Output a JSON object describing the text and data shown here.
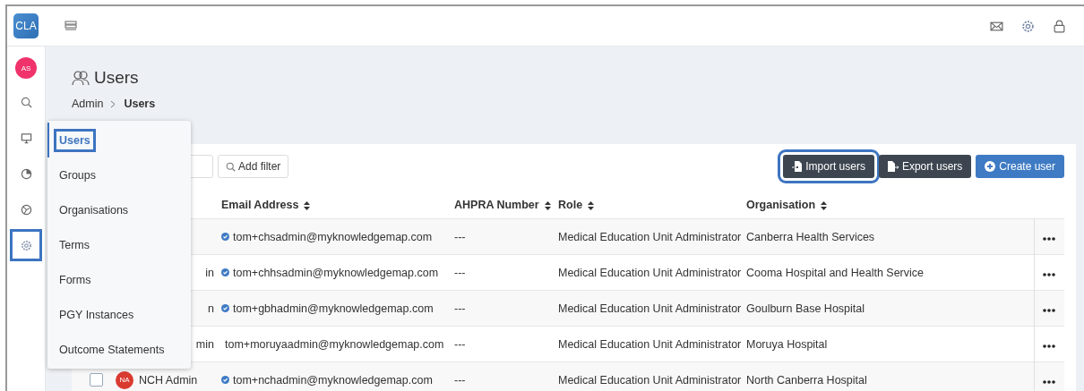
{
  "app": {
    "logo": "CLA"
  },
  "user_avatar": {
    "initials": "AS"
  },
  "rail_icons": [
    {
      "kind": "search",
      "highlighted": false
    },
    {
      "kind": "monitor",
      "highlighted": false
    },
    {
      "kind": "gauge",
      "highlighted": false
    },
    {
      "kind": "globe",
      "highlighted": false
    },
    {
      "kind": "gear",
      "highlighted": true
    }
  ],
  "header_icons": [
    {
      "kind": "mail"
    },
    {
      "kind": "gear"
    },
    {
      "kind": "lock"
    }
  ],
  "page": {
    "title": "Users",
    "breadcrumb": [
      {
        "label": "Admin",
        "current": false
      },
      {
        "label": "Users",
        "current": true
      }
    ]
  },
  "admin_menu": [
    {
      "label": "Users",
      "selected": true,
      "highlighted": true
    },
    {
      "label": "Groups",
      "selected": false,
      "highlighted": false
    },
    {
      "label": "Organisations",
      "selected": false,
      "highlighted": false
    },
    {
      "label": "Terms",
      "selected": false,
      "highlighted": false
    },
    {
      "label": "Forms",
      "selected": false,
      "highlighted": false
    },
    {
      "label": "PGY Instances",
      "selected": false,
      "highlighted": false
    },
    {
      "label": "Outcome Statements",
      "selected": false,
      "highlighted": false
    }
  ],
  "toolbar": {
    "filter_button": "Add filter",
    "actions": [
      {
        "label": "Import users",
        "kind": "import",
        "highlighted": true
      },
      {
        "label": "Export users",
        "kind": "export",
        "highlighted": false
      },
      {
        "label": "Create user",
        "kind": "create",
        "highlighted": false
      }
    ]
  },
  "table": {
    "columns": [
      "Email Address",
      "AHPRA Number",
      "Role",
      "Organisation"
    ],
    "rows": [
      {
        "email": "tom+chsadmin@myknowledgemap.com",
        "ahpra": "---",
        "role": "Medical Education Unit Administrator",
        "organisation": "Canberra Health Services"
      },
      {
        "name": "in",
        "email": "tom+chhsadmin@myknowledgemap.com",
        "ahpra": "---",
        "role": "Medical Education Unit Administrator",
        "organisation": "Cooma Hospital and Health Service"
      },
      {
        "name": "n",
        "email": "tom+gbhadmin@myknowledgemap.com",
        "ahpra": "---",
        "role": "Medical Education Unit Administrator",
        "organisation": "Goulburn Base Hospital"
      },
      {
        "name": "min",
        "email": "tom+moruyaadmin@myknowledgemap.com",
        "ahpra": "---",
        "role": "Medical Education Unit Administrator",
        "organisation": "Moruya Hospital"
      },
      {
        "checked": false,
        "avatar": "NA",
        "name": "NCH Admin",
        "email": "tom+nchadmin@myknowledgemap.com",
        "ahpra": "---",
        "role": "Medical Education Unit Administrator",
        "organisation": "North Canberra Hospital"
      }
    ]
  }
}
